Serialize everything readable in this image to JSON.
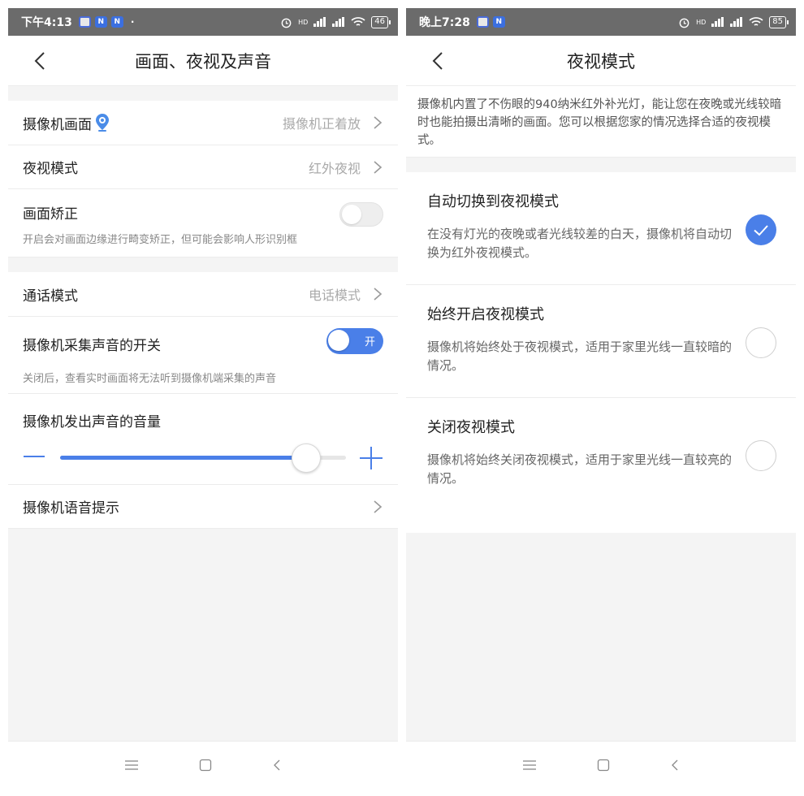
{
  "left": {
    "status_bar": {
      "time": "下午4:13",
      "n1": "N",
      "n2": "N",
      "dot": "·",
      "signal": "HD",
      "battery": "46"
    },
    "header": {
      "title": "画面、夜视及声音"
    },
    "camera_view": {
      "label": "摄像机画面",
      "value": "摄像机正着放"
    },
    "night_mode": {
      "label": "夜视模式",
      "value": "红外夜视"
    },
    "correction": {
      "label": "画面矫正",
      "desc": "开启会对画面边缘进行畸变矫正，但可能会影响人形识别框"
    },
    "call_mode": {
      "label": "通话模式",
      "value": "电话模式"
    },
    "sound_capture": {
      "label": "摄像机采集声音的开关",
      "toggle_text": "开",
      "desc": "关闭后，查看实时画面将无法听到摄像机端采集的声音"
    },
    "volume": {
      "label": "摄像机发出声音的音量",
      "level": 0.86
    },
    "voice_prompt": {
      "label": "摄像机语音提示"
    }
  },
  "right": {
    "status_bar": {
      "time": "晚上7:28",
      "n1": "N",
      "signal": "HD",
      "battery": "85"
    },
    "header": {
      "title": "夜视模式"
    },
    "intro": "摄像机内置了不伤眼的940纳米红外补光灯，能让您在夜晚或光线较暗时也能拍摄出清晰的画面。您可以根据您家的情况选择合适的夜视模式。",
    "options": [
      {
        "title": "自动切换到夜视模式",
        "desc": "在没有灯光的夜晚或者光线较差的白天，摄像机将自动切换为红外夜视模式。",
        "selected": true
      },
      {
        "title": "始终开启夜视模式",
        "desc": "摄像机将始终处于夜视模式，适用于家里光线一直较暗的情况。",
        "selected": false
      },
      {
        "title": "关闭夜视模式",
        "desc": "摄像机将始终关闭夜视模式，适用于家里光线一直较亮的情况。",
        "selected": false
      }
    ]
  },
  "colors": {
    "accent": "#4a7fe8",
    "status_bar": "#6b6b6b",
    "background_grey": "#f4f4f4"
  }
}
